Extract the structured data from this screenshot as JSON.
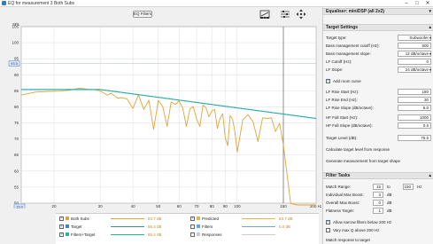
{
  "window": {
    "title": "EQ for measurement 3 Both Subs",
    "controls": [
      "–",
      "□",
      "✕"
    ]
  },
  "toolbar": {
    "eq_filters_label": "EQ Filters"
  },
  "plot": {
    "y_unit": "SPL",
    "y_ticks": [
      "105",
      "100",
      "95",
      "90",
      "85",
      "80",
      "75",
      "70",
      "65",
      "60",
      "55",
      "50"
    ],
    "y_marker": "93.5",
    "x_ticks": [
      "15",
      "20",
      "30",
      "40",
      "50",
      "60",
      "70",
      "80",
      "90",
      "100",
      "150",
      "200 Hz"
    ],
    "x_marker": "15.0"
  },
  "chart_data": {
    "type": "line",
    "xlabel": "",
    "ylabel": "SPL",
    "x_scale": "log",
    "xlim": [
      15,
      200
    ],
    "ylim": [
      50,
      105
    ],
    "grid": true,
    "series": [
      {
        "name": "Both Subs",
        "color": "#e0a33a",
        "x": [
          15,
          17,
          19,
          21,
          23,
          25,
          27,
          29,
          30,
          32,
          33,
          35,
          36,
          38,
          40,
          42,
          44,
          46,
          48,
          50,
          52,
          54,
          56,
          58,
          60,
          62,
          64,
          66,
          68,
          70,
          72,
          74,
          76,
          78,
          80,
          82,
          84,
          86,
          88,
          90,
          92,
          94,
          96,
          98,
          100,
          105,
          110,
          115,
          120,
          125,
          130,
          135,
          140,
          145,
          150,
          160,
          170,
          180,
          190,
          200
        ],
        "y": [
          83.7,
          84.6,
          84.8,
          84.9,
          85.2,
          85.8,
          85.5,
          85.3,
          85.0,
          83.6,
          84.3,
          82.7,
          82.9,
          82.5,
          79.5,
          83.8,
          79.2,
          82.1,
          73.0,
          82.0,
          80.1,
          73.9,
          81.5,
          80.8,
          81.8,
          79.6,
          73.9,
          79.4,
          80.1,
          76.2,
          73.9,
          80.6,
          79.8,
          76.9,
          78.7,
          79.2,
          73.3,
          76.4,
          77.9,
          70.6,
          67.9,
          77.3,
          76.2,
          72.3,
          65.9,
          76.0,
          77.6,
          75.3,
          69.2,
          76.6,
          76.4,
          76.6,
          72.3,
          74.9,
          68.2,
          49.9,
          49.4,
          46.5,
          45.0,
          44.0
        ]
      },
      {
        "name": "Target",
        "color": "#3f7fd4",
        "x": [
          15,
          30,
          200
        ],
        "y": [
          85.4,
          85.4,
          76.4
        ]
      },
      {
        "name": "Filters+Target",
        "color": "#26b5a5",
        "x": [
          15,
          30,
          200
        ],
        "y": [
          85.4,
          85.4,
          76.4
        ]
      },
      {
        "name": "Predicted",
        "color": "#e7b14b",
        "x": [],
        "y": []
      },
      {
        "name": "Filters",
        "color": "#6aa5e0",
        "x": [],
        "y": []
      },
      {
        "name": "Responses",
        "color": "#cccccc",
        "x": [],
        "y": []
      }
    ]
  },
  "legend": {
    "left": [
      {
        "name": "Both Subs",
        "value": "83.7 dB",
        "checked": true,
        "color": "#e0a33a"
      },
      {
        "name": "Target",
        "value": "85.4 dB",
        "checked": true,
        "color": "#3f7fd4"
      },
      {
        "name": "Filters+Target",
        "value": "85.4 dB",
        "checked": true,
        "color": "#26b5a5"
      }
    ],
    "right": [
      {
        "name": "Predicted",
        "value": "83.7 dB",
        "checked": true,
        "color": "#e7b14b"
      },
      {
        "name": "Filters",
        "value": "0.0 dB",
        "checked": false,
        "color": "#6aa5e0"
      },
      {
        "name": "Responses",
        "value": "",
        "checked": false,
        "color": "#cccccc"
      }
    ]
  },
  "right_panel": {
    "equaliser_header": "Equaliser: miniDSP (all 2x2)",
    "target_settings": {
      "header": "Target Settings",
      "target_type_label": "Target type:",
      "target_type_value": "Subwoofer",
      "bm_cutoff_label": "Bass management cutoff (Hz):",
      "bm_cutoff_value": "500",
      "bm_slope_label": "Bass management slope:",
      "bm_slope_value": "12 dB/octave",
      "lf_cutoff_label": "LF Cutoff (Hz):",
      "lf_cutoff_value": "0",
      "lf_slope_label": "LF Slope:",
      "lf_slope_value": "24 dB/octave",
      "add_room_curve_label": "Add room curve",
      "add_room_curve_checked": true,
      "lf_rise_start_label": "LF Rise Start (Hz):",
      "lf_rise_start_value": "180",
      "lf_rise_end_label": "LF Rise End (Hz):",
      "lf_rise_end_value": "30",
      "lf_rise_slope_label": "LF Rise Slope (dB/octave):",
      "lf_rise_slope_value": "6.0",
      "hf_fall_start_label": "HF Fall Start (Hz):",
      "hf_fall_start_value": "1000",
      "hf_fall_slope_label": "HF Fall Slope (dB/octave):",
      "hf_fall_slope_value": "0.5",
      "target_level_label": "Target Level (dB):",
      "target_level_value": "75.5",
      "calc_button": "Calculate target level from response",
      "generate_button": "Generate measurement from target shape"
    },
    "filter_tasks": {
      "header": "Filter Tasks",
      "match_range_label": "Match Range:",
      "match_range_from": "15",
      "match_range_to": "150",
      "match_range_sep": "to",
      "indiv_max_boost_label": "Individual Max Boost:",
      "indiv_max_boost_value": "3",
      "overall_max_boost_label": "Overall Max Boost:",
      "overall_max_boost_value": "0",
      "flatness_label": "Flatness Target:",
      "flatness_value": "1",
      "unit_hz": "Hz",
      "unit_db": "dB",
      "allow_narrow_label": "Allow narrow filters below 200 Hz",
      "allow_narrow_checked": true,
      "vary_q_label": "Vary max Q above 200 Hz",
      "vary_q_checked": false,
      "match_response_label": "Match response to target"
    }
  }
}
